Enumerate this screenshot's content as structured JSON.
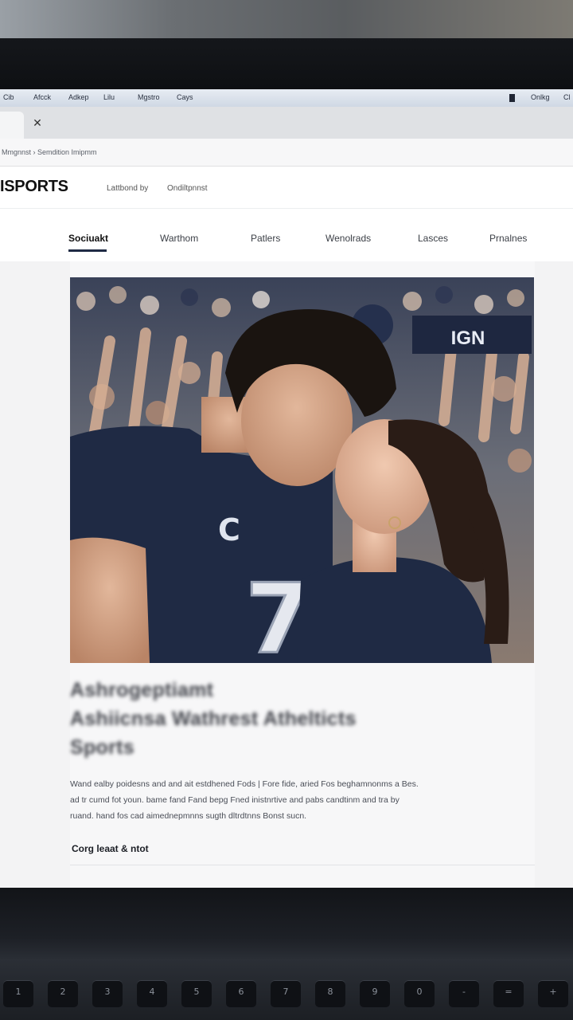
{
  "menubar": {
    "items": [
      "Cib",
      "Afcck",
      "Adkep",
      "Lilu",
      "Mgstro",
      "Cays"
    ],
    "right_items": [
      "Onlkg",
      "Cl"
    ]
  },
  "breadcrumb": "Mmgnnst › Semdition Imipmm",
  "site": {
    "logo": "ISPORTS",
    "tagline_1": "Lattbond by",
    "tagline_2": "Ondiltpnnst"
  },
  "nav": {
    "items": [
      "Sociuakt",
      "Warthom",
      "Patlers",
      "Wenolrads",
      "Lasces",
      "Prnalnes"
    ],
    "active_index": 0
  },
  "hero": {
    "jersey_letter": "C",
    "jersey_number": "7",
    "banner_text": "IGN"
  },
  "article": {
    "headline_lines": [
      "Ashrogeptiamt",
      "Ashiicnsa Wathrest Athelticts",
      "Sports"
    ],
    "body_lines": [
      "Wand ealby poidesns and and ait estdhened Fods | Fore fide, aried Fos beghamnonms a Bes.",
      "ad tr cumd fot youn. bame fand Fand bepg Fned inistnrtive and pabs candtinm and tra by",
      "ruand. hand fos cad aimednepmnns sugth dltrdtnns Bonst sucn."
    ],
    "cta": "Corg leaat & ntot"
  },
  "keyboard": {
    "keys": [
      "1",
      "2",
      "3",
      "4",
      "5",
      "6",
      "7",
      "8",
      "9",
      "0",
      "-",
      "=",
      "+"
    ]
  },
  "colors": {
    "nav_underline": "#1f2a44",
    "jersey": "#1f2a44",
    "screen_bg": "#f1f1f2"
  }
}
